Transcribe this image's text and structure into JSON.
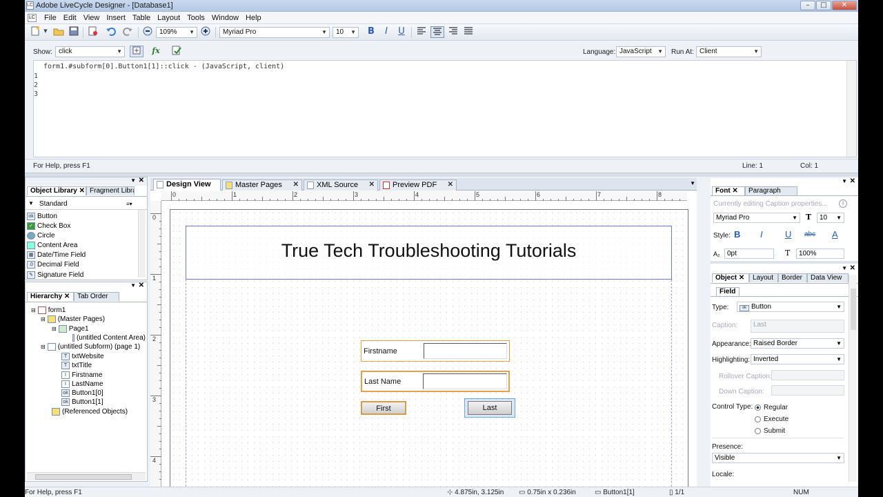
{
  "window": {
    "title": "Adobe LiveCycle Designer - [Database1]",
    "min": "–",
    "max": "□",
    "close": "✕"
  },
  "menu": [
    "File",
    "Edit",
    "View",
    "Insert",
    "Table",
    "Layout",
    "Tools",
    "Window",
    "Help"
  ],
  "toolbar": {
    "zoom": "109%",
    "font": "Myriad Pro",
    "size": "10",
    "bold": "B",
    "italic": "I",
    "underline": "U"
  },
  "script": {
    "show_label": "Show:",
    "show_value": "click",
    "language_label": "Language:",
    "language_value": "JavaScript",
    "runat_label": "Run At:",
    "runat_value": "Client",
    "fx": "fx"
  },
  "editor": {
    "header": "form1.#subform[0].Button1[1]::click - (JavaScript, client)",
    "lines": [
      "1",
      "2",
      "3"
    ]
  },
  "status_top": {
    "help": "For Help, press F1",
    "line": "Line: 1",
    "col": "Col: 1"
  },
  "object_library": {
    "tabs": [
      "Object Library",
      "Fragment Library"
    ],
    "category": "Standard",
    "items": [
      "Button",
      "Check Box",
      "Circle",
      "Content Area",
      "Date/Time Field",
      "Decimal Field",
      "Signature Field"
    ]
  },
  "hierarchy": {
    "tabs": [
      "Hierarchy",
      "Tab Order"
    ],
    "nodes": [
      {
        "label": "form1"
      },
      {
        "label": "(Master Pages)"
      },
      {
        "label": "Page1"
      },
      {
        "label": "(untitled Content Area)"
      },
      {
        "label": "(untitled Subform) (page 1)"
      },
      {
        "label": "txtWebsite"
      },
      {
        "label": "txtTitle"
      },
      {
        "label": "Firstname"
      },
      {
        "label": "LastName"
      },
      {
        "label": "Button1[0]"
      },
      {
        "label": "Button1[1]"
      },
      {
        "label": "(Referenced Objects)"
      }
    ]
  },
  "design_tabs": [
    "Design View",
    "Master Pages",
    "XML Source",
    "Preview PDF"
  ],
  "ruler": {
    "h": [
      "0",
      "1",
      "2",
      "3",
      "4",
      "5",
      "6",
      "7",
      "8"
    ],
    "v": [
      "0",
      "1",
      "2",
      "3",
      "4"
    ]
  },
  "form": {
    "title": "True Tech Troubleshooting Tutorials",
    "firstname_caption": "Firstname",
    "lastname_caption": "Last Name",
    "button_first": "First",
    "button_last": "Last"
  },
  "font_panel": {
    "tabs": [
      "Font",
      "Paragraph"
    ],
    "note": "Currently editing Caption properties...",
    "font": "Myriad Pro",
    "size": "10",
    "style_label": "Style:",
    "baseline": "0pt",
    "scale": "100%"
  },
  "object_panel": {
    "tabs": [
      "Object",
      "Layout",
      "Border",
      "Data View"
    ],
    "subtab": "Field",
    "type_label": "Type:",
    "type_value": "Button",
    "caption_label": "Caption:",
    "caption_value": "Last",
    "appearance_label": "Appearance:",
    "appearance_value": "Raised Border",
    "highlighting_label": "Highlighting:",
    "highlighting_value": "Inverted",
    "rollover_label": "Rollover Caption:",
    "down_label": "Down Caption:",
    "control_label": "Control Type:",
    "control_options": [
      "Regular",
      "Execute",
      "Submit"
    ],
    "presence_label": "Presence:",
    "presence_value": "Visible",
    "locale_label": "Locale:"
  },
  "status_bottom": {
    "help": "For Help, press F1",
    "position": "4.875in, 3.125in",
    "size": "0.75in x 0.236in",
    "object": "Button1[1]",
    "page": "1/1",
    "num": "NUM"
  }
}
